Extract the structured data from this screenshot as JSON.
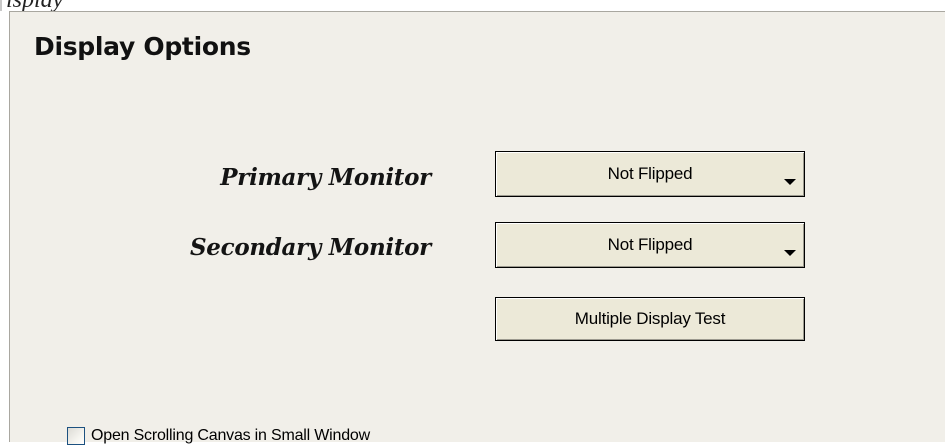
{
  "top_strip": {
    "partial_text": "isplay"
  },
  "page": {
    "title": "Display Options"
  },
  "monitors": {
    "primary": {
      "label": "Primary Monitor",
      "selected_value": "Not Flipped"
    },
    "secondary": {
      "label": "Secondary Monitor",
      "selected_value": "Not Flipped"
    }
  },
  "actions": {
    "test_button_label": "Multiple Display Test"
  },
  "options": {
    "scrolling_canvas": {
      "label": "Open Scrolling Canvas in Small Window",
      "checked": false
    }
  },
  "icons": {
    "dropdown_arrow": "chevron-down-icon"
  }
}
